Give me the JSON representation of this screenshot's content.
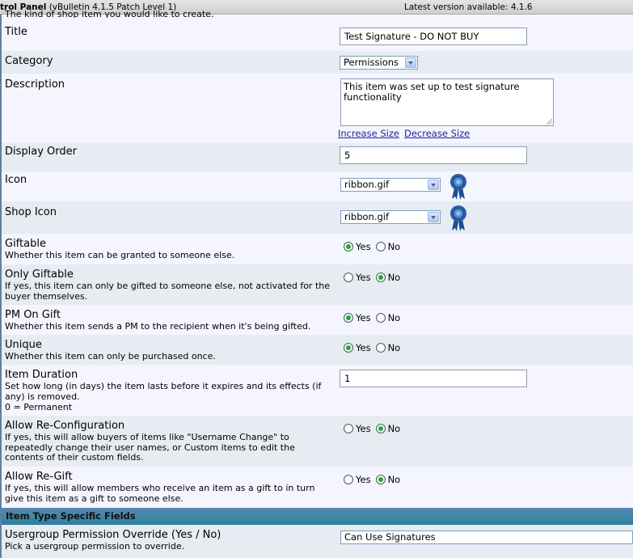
{
  "topbar": {
    "left_bold": "trol Panel",
    "left_rest": " (vBulletin 4.1.5 Patch Level 1)",
    "right": "Latest version available: 4.1.6"
  },
  "cut_text": "The kind of shop item you would like to create.",
  "fields": {
    "title": {
      "label": "Title",
      "value": "Test Signature - DO NOT BUY"
    },
    "category": {
      "label": "Category",
      "value": "Permissions"
    },
    "description": {
      "label": "Description",
      "value": "This item was set up to test signature functionality",
      "increase": "Increase Size",
      "decrease": "Decrease Size"
    },
    "display_order": {
      "label": "Display Order",
      "value": "5"
    },
    "icon": {
      "label": "Icon",
      "value": "ribbon.gif",
      "image": "ribbon-icon"
    },
    "shop_icon": {
      "label": "Shop Icon",
      "value": "ribbon.gif",
      "image": "ribbon-icon"
    },
    "giftable": {
      "label": "Giftable",
      "desc": "Whether this item can be granted to someone else.",
      "selected": "Yes"
    },
    "only_giftable": {
      "label": "Only Giftable",
      "desc": "If yes, this item can only be gifted to someone else, not activated for the buyer themselves.",
      "selected": "No"
    },
    "pm_on_gift": {
      "label": "PM On Gift",
      "desc": "Whether this item sends a PM to the recipient when it's being gifted.",
      "selected": "Yes"
    },
    "unique": {
      "label": "Unique",
      "desc": "Whether this item can only be purchased once.",
      "selected": "Yes"
    },
    "item_duration": {
      "label": "Item Duration",
      "desc": "Set how long (in days) the item lasts before it expires and its effects (if any) is removed.",
      "desc2": "0 = Permanent",
      "value": "1"
    },
    "allow_reconfig": {
      "label": "Allow Re-Configuration",
      "desc": "If yes, this will allow buyers of items like \"Username Change\" to repeatedly change their user names, or Custom items to edit the contents of their custom fields.",
      "selected": "No"
    },
    "allow_regift": {
      "label": "Allow Re-Gift",
      "desc": "If yes, this will allow members who receive an item as a gift to in turn give this item as a gift to someone else.",
      "selected": "No"
    }
  },
  "radio_labels": {
    "yes": "Yes",
    "no": "No"
  },
  "section": {
    "title": "Item Type Specific Fields"
  },
  "usergroup": {
    "label": "Usergroup Permission Override (Yes / No)",
    "desc": "Pick a usergroup permission to override.",
    "value": "Can Use Signatures"
  },
  "colors": {
    "row_alt1": "#f5f5ff",
    "row_alt2": "#e7ecf2",
    "section_bar": "#3b87a6",
    "radio_on": "#2aa13f"
  }
}
